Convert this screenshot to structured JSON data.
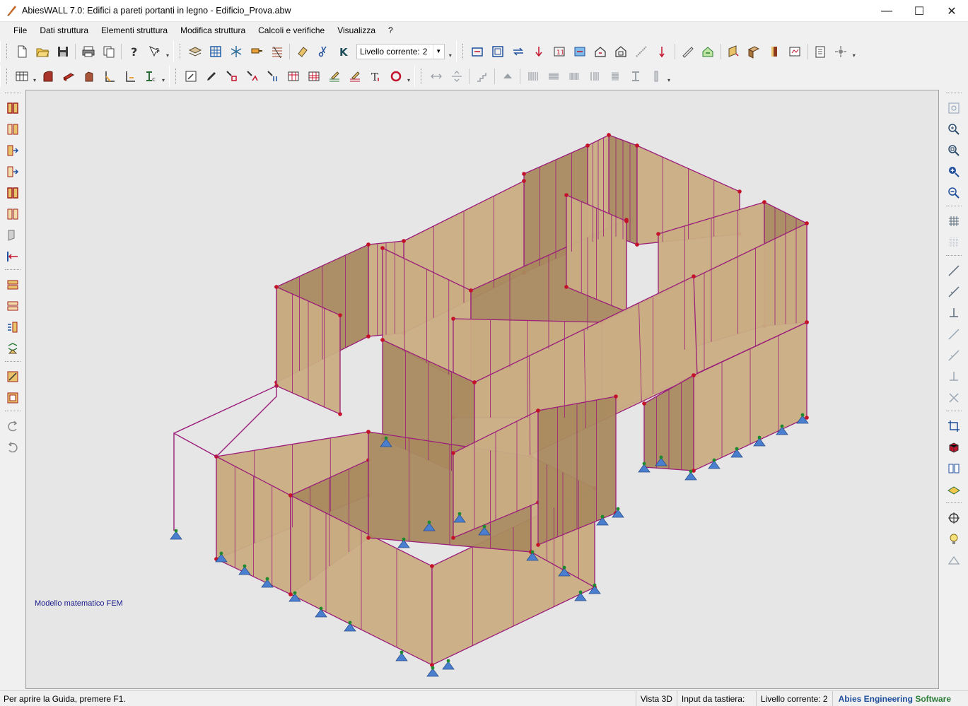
{
  "window": {
    "title": "AbiesWALL 7.0: Edifici a pareti portanti in legno - Edificio_Prova.abw",
    "controls": {
      "minimize": "—",
      "maximize": "☐",
      "close": "✕"
    }
  },
  "menu": {
    "items": [
      "File",
      "Dati struttura",
      "Elementi struttura",
      "Modifica struttura",
      "Calcoli e verifiche",
      "Visualizza",
      "?"
    ]
  },
  "toolbar": {
    "level_label": "Livello corrente:",
    "level_value": "2",
    "level_options_open": false
  },
  "viewport": {
    "view_mode": "3D",
    "fem_label": "Modello matematico FEM",
    "colors": {
      "background": "#e6e6e6",
      "wall_light": "#c9ad83",
      "wall_dark": "#a98a5f",
      "edge": "#9b1e7a",
      "node": "#c4122a",
      "support": "#4a7fd0",
      "mid_node": "#1e8a2e"
    }
  },
  "status": {
    "help": "Per aprire la Guida, premere F1.",
    "view": "Vista 3D",
    "input": "Input da tastiera:",
    "level": "Livello corrente:  2",
    "brand_a": "Abies Engineering",
    "brand_b": "Software"
  },
  "icons": {
    "top_row": [
      "new-file-icon",
      "open-folder-icon",
      "save-icon",
      "print-icon",
      "copy-icon",
      "help-icon",
      "context-help-icon",
      "layers-icon",
      "grid-icon",
      "snowflake-icon",
      "tool-icon",
      "hatch-icon",
      "eraser-icon",
      "scissors-icon",
      "k-icon",
      "level-icon",
      "frame-icon",
      "arrows-icon",
      "load-down-icon",
      "span-icon",
      "panel-icon",
      "house-icon",
      "roof-icon",
      "beam-icon",
      "arrow-icon",
      "ruler-icon",
      "check-icon",
      "wall-3d-icon",
      "wall-red-icon",
      "column-icon",
      "dim-icon",
      "report-icon",
      "settings-icon"
    ],
    "left_bar": [
      "wall-icon",
      "wall-2-icon",
      "wall-arrow-icon",
      "wall-arrow-2-icon",
      "wall-3-icon",
      "wall-4-icon",
      "wall-5-icon",
      "align-icon",
      "floor-icon",
      "floor-2-icon",
      "load-icon",
      "support-icon",
      "measure-icon",
      "frame-2-icon",
      "rotate-left-icon",
      "rotate-right-icon"
    ],
    "right_bar": [
      "fit-icon",
      "zoom-window-icon",
      "zoom-select-icon",
      "zoom-in-icon",
      "zoom-out-icon",
      "grid-icon",
      "dotted-grid-icon",
      "line-icon",
      "line-2-icon",
      "anchor-icon",
      "line-3-icon",
      "line-4-icon",
      "anchor-2-icon",
      "cross-icon",
      "crop-icon",
      "cube-icon",
      "book-icon",
      "plane-icon",
      "target-icon",
      "bulb-icon",
      "light-icon"
    ]
  }
}
